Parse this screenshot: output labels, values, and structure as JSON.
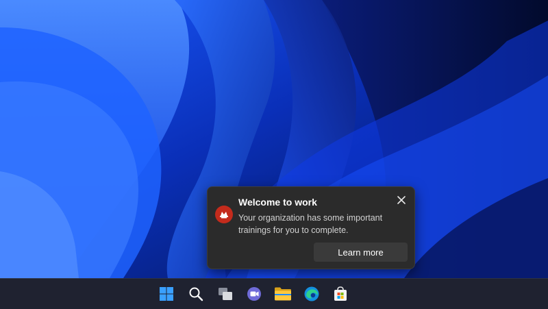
{
  "notification": {
    "title": "Welcome to work",
    "body": "Your organization has some important trainings for you to complete.",
    "action_label": "Learn more",
    "app_icon": "training-app-icon",
    "close_icon": "close-icon"
  },
  "taskbar": {
    "items": [
      {
        "name": "start",
        "icon": "windows-logo-icon"
      },
      {
        "name": "search",
        "icon": "search-icon"
      },
      {
        "name": "task-view",
        "icon": "task-view-icon"
      },
      {
        "name": "chat",
        "icon": "teams-chat-icon"
      },
      {
        "name": "file-explorer",
        "icon": "folder-icon"
      },
      {
        "name": "edge",
        "icon": "edge-browser-icon"
      },
      {
        "name": "store",
        "icon": "store-icon"
      }
    ]
  },
  "colors": {
    "accent_blue": "#1452ff",
    "toast_background": "#2b2b2b",
    "app_icon_red": "#c42b1c",
    "taskbar": "#1f2230"
  }
}
